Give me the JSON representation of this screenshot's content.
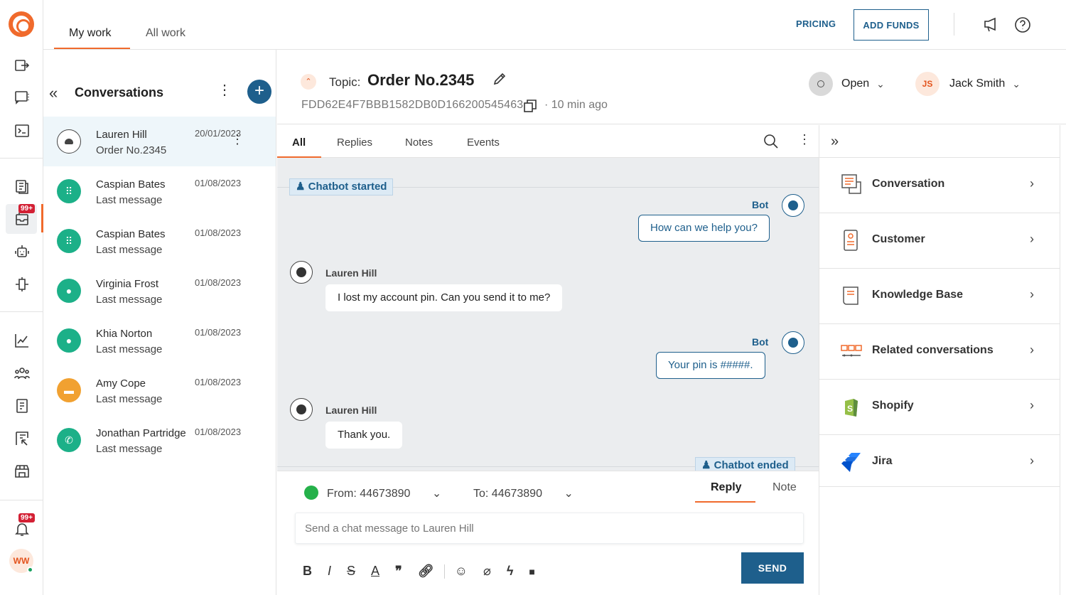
{
  "topbar": {
    "tabs": [
      {
        "label": "My work"
      },
      {
        "label": "All work"
      }
    ],
    "pricing": "PRICING",
    "add_funds": "ADD FUNDS"
  },
  "rail": {
    "badge_inbox": "99+",
    "badge_notifications": "99+",
    "user_initials": "WW"
  },
  "conversations": {
    "title": "Conversations",
    "items": [
      {
        "name": "Lauren Hill",
        "message": "Order No.2345",
        "date": "20/01/2023",
        "channel": "email-icon",
        "color": "#555555",
        "selected": true
      },
      {
        "name": "Caspian Bates",
        "message": "Last message",
        "date": "01/08/2023",
        "channel": "dialpad-icon",
        "color": "#1cb088"
      },
      {
        "name": "Caspian Bates",
        "message": "Last message",
        "date": "01/08/2023",
        "channel": "dialpad-icon",
        "color": "#1cb088"
      },
      {
        "name": "Virginia Frost",
        "message": "Last message",
        "date": "01/08/2023",
        "channel": "chat-icon",
        "color": "#1cb088"
      },
      {
        "name": "Khia Norton",
        "message": "Last message",
        "date": "01/08/2023",
        "channel": "chat-icon",
        "color": "#1cb088"
      },
      {
        "name": "Amy Cope",
        "message": "Last message",
        "date": "01/08/2023",
        "channel": "sms-icon",
        "color": "#f1a131"
      },
      {
        "name": "Jonathan Partridge",
        "message": "Last message",
        "date": "01/08/2023",
        "channel": "whatsapp-icon",
        "color": "#1cb088"
      }
    ]
  },
  "header": {
    "topic_label": "Topic:",
    "topic_value": "Order No.2345",
    "conversation_id": "FDD62E4F7BBB1582DB0D166200545463",
    "time_ago": "10 min ago",
    "status": "Open",
    "agent_initials": "JS",
    "agent_name": "Jack Smith"
  },
  "tabs": [
    {
      "label": "All"
    },
    {
      "label": "Replies"
    },
    {
      "label": "Notes"
    },
    {
      "label": "Events"
    }
  ],
  "messages": {
    "chatbot_started": "Chatbot started",
    "chatbot_ended": "Chatbot ended",
    "bot_name": "Bot",
    "customer_name": "Lauren Hill",
    "bot_1": "How can we help you?",
    "user_1": "I lost my account pin. Can you send it to me?",
    "bot_2": "Your pin is #####.",
    "user_2": "Thank you."
  },
  "composer": {
    "from": "From: 44673890",
    "to": "To: 44673890",
    "reply_tab": "Reply",
    "note_tab": "Note",
    "placeholder": "Send a chat message to Lauren Hill",
    "send": "SEND",
    "tools": [
      "B",
      "I",
      "S",
      "A"
    ]
  },
  "right_panel": {
    "items": [
      {
        "label": "Conversation"
      },
      {
        "label": "Customer"
      },
      {
        "label": "Knowledge Base"
      },
      {
        "label": "Related conversations"
      },
      {
        "label": "Shopify"
      },
      {
        "label": "Jira"
      }
    ]
  },
  "colors": {
    "accent": "#f06a2c",
    "primary": "#1e5f8c",
    "badge": "#d32034"
  }
}
